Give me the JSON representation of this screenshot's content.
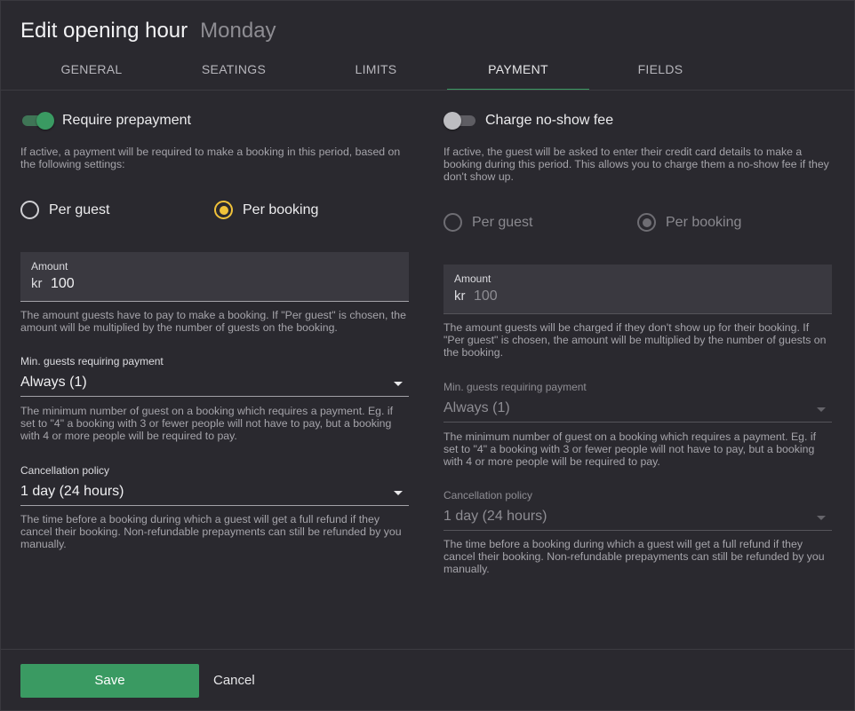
{
  "header": {
    "title": "Edit opening hour",
    "subtitle": "Monday"
  },
  "tabs": [
    {
      "label": "GENERAL"
    },
    {
      "label": "SEATINGS"
    },
    {
      "label": "LIMITS"
    },
    {
      "label": "PAYMENT",
      "active": true
    },
    {
      "label": "FIELDS"
    }
  ],
  "prepayment": {
    "toggle_label": "Require prepayment",
    "enabled": true,
    "description": "If active, a payment will be required to make a booking in this period, based on the following settings:",
    "radio_per_guest": "Per guest",
    "radio_per_booking": "Per booking",
    "selected": "Per booking",
    "amount_label": "Amount",
    "amount_prefix": "kr",
    "amount_value": "100",
    "amount_help": "The amount guests have to pay to make a booking. If \"Per guest\" is chosen, the amount will be multiplied by the number of guests on the booking.",
    "min_guests_label": "Min. guests requiring payment",
    "min_guests_value": "Always (1)",
    "min_guests_help": "The minimum number of guest on a booking which requires a payment. Eg. if set to \"4\" a booking with 3 or fewer people will not have to pay, but a booking with 4 or more people will be required to pay.",
    "cancellation_label": "Cancellation policy",
    "cancellation_value": "1 day (24 hours)",
    "cancellation_help": "The time before a booking during which a guest will get a full refund if they cancel their booking. Non-refundable prepayments can still be refunded by you manually."
  },
  "noshow": {
    "toggle_label": "Charge no-show fee",
    "enabled": false,
    "description": "If active, the guest will be asked to enter their credit card details to make a booking during this period. This allows you to charge them a no-show fee if they don't show up.",
    "radio_per_guest": "Per guest",
    "radio_per_booking": "Per booking",
    "selected": "Per booking",
    "amount_label": "Amount",
    "amount_prefix": "kr",
    "amount_value": "100",
    "amount_help": "The amount guests will be charged if they don't show up for their booking. If \"Per guest\" is chosen, the amount will be multiplied by the number of guests on the booking.",
    "min_guests_label": "Min. guests requiring payment",
    "min_guests_value": "Always (1)",
    "min_guests_help": "The minimum number of guest on a booking which requires a payment. Eg. if set to \"4\" a booking with 3 or fewer people will not have to pay, but a booking with 4 or more people will be required to pay.",
    "cancellation_label": "Cancellation policy",
    "cancellation_value": "1 day (24 hours)",
    "cancellation_help": "The time before a booking during which a guest will get a full refund if they cancel their booking. Non-refundable prepayments can still be refunded by you manually."
  },
  "footer": {
    "save_label": "Save",
    "cancel_label": "Cancel"
  },
  "colors": {
    "accent": "#3a9a62",
    "radio_selected": "#f0c23a",
    "background": "#2a292f"
  }
}
